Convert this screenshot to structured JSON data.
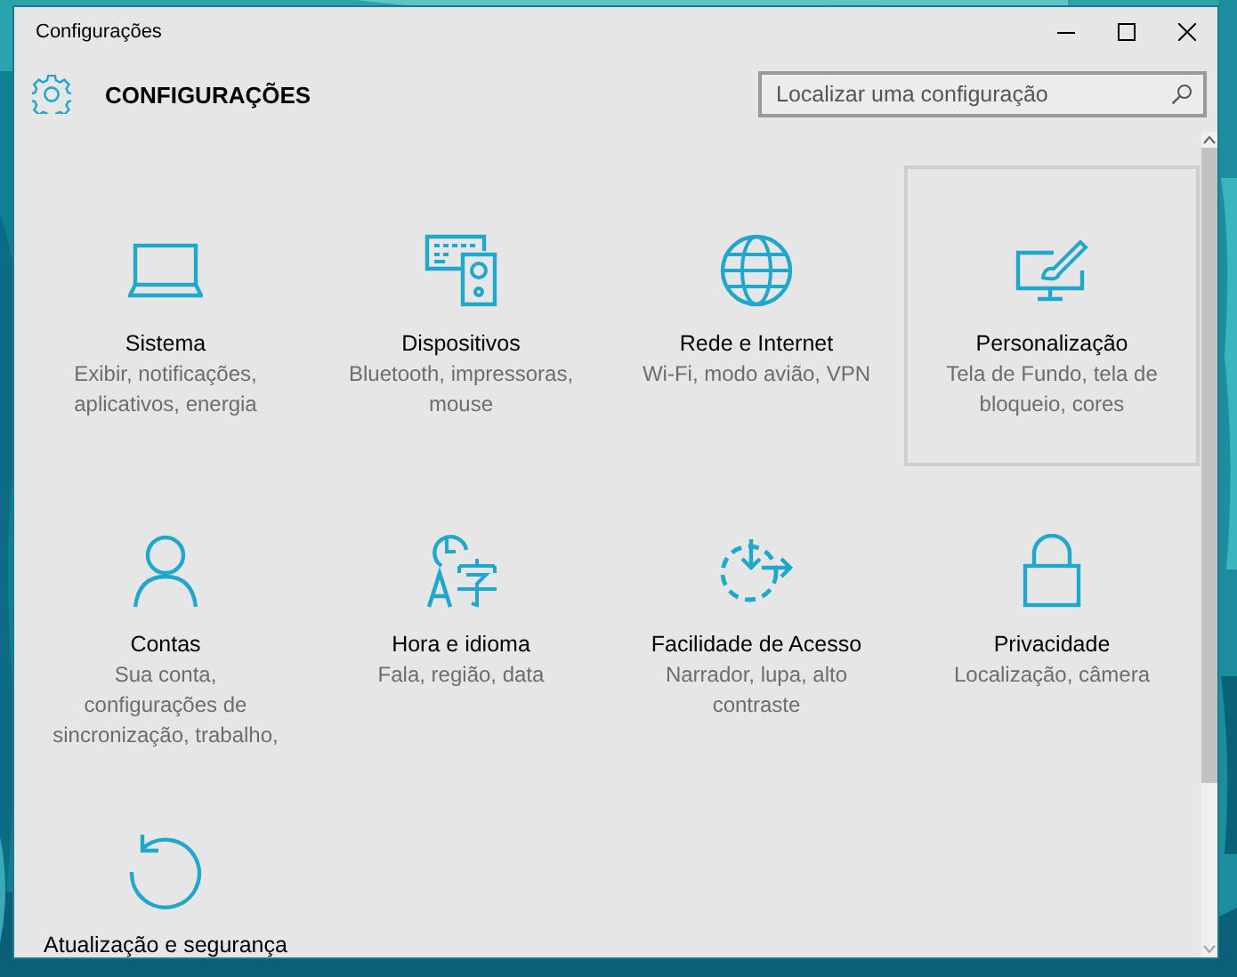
{
  "window": {
    "title": "Configurações"
  },
  "header": {
    "title": "CONFIGURAÇÕES"
  },
  "search": {
    "placeholder": "Localizar uma configuração"
  },
  "categories": [
    {
      "kind": "laptop",
      "title": "Sistema",
      "description": [
        "Exibir, notificações,",
        "aplicativos, energia"
      ],
      "hovered": false
    },
    {
      "kind": "devices",
      "title": "Dispositivos",
      "description": [
        "Bluetooth, impressoras,",
        "mouse"
      ],
      "hovered": false
    },
    {
      "kind": "globe",
      "title": "Rede e Internet",
      "description": [
        "Wi-Fi, modo avião, VPN"
      ],
      "hovered": false
    },
    {
      "kind": "personalize",
      "title": "Personalização",
      "description": [
        "Tela de Fundo, tela de",
        "bloqueio, cores"
      ],
      "hovered": true
    },
    {
      "kind": "person",
      "title": "Contas",
      "description": [
        "Sua conta,",
        "configurações de",
        "sincronização, trabalho,"
      ],
      "hovered": false
    },
    {
      "kind": "time-language",
      "title": "Hora e idioma",
      "description": [
        "Fala, região, data"
      ],
      "hovered": false
    },
    {
      "kind": "accessibility",
      "title": "Facilidade de Acesso",
      "description": [
        "Narrador, lupa, alto",
        "contraste"
      ],
      "hovered": false
    },
    {
      "kind": "lock",
      "title": "Privacidade",
      "description": [
        "Localização, câmera"
      ],
      "hovered": false
    },
    {
      "kind": "update",
      "title": "Atualização e segurança",
      "hovered": false
    }
  ]
}
